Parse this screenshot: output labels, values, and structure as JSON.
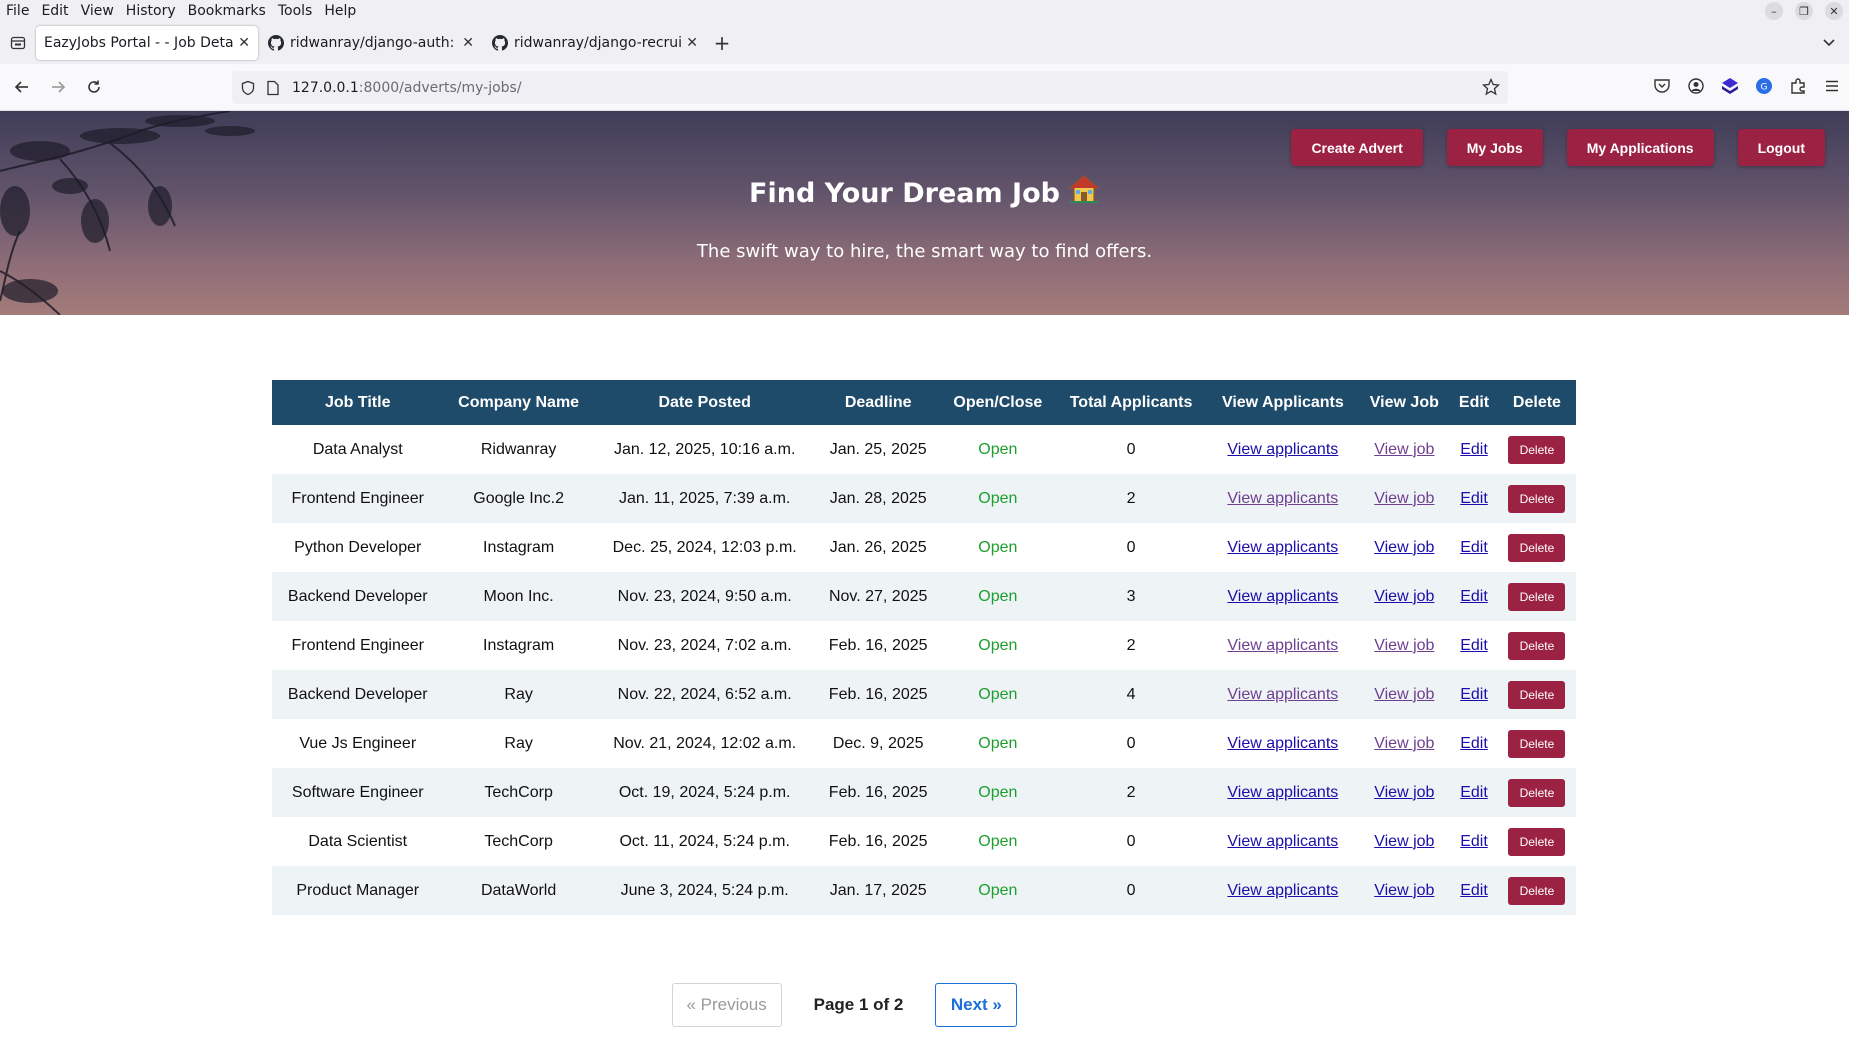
{
  "browser": {
    "menu": [
      "File",
      "Edit",
      "View",
      "History",
      "Bookmarks",
      "Tools",
      "Help"
    ],
    "tabs": [
      {
        "label": "EazyJobs Portal - - Job Detai",
        "active": true
      },
      {
        "label": "ridwanray/django-auth: A",
        "active": false
      },
      {
        "label": "ridwanray/django-recruit",
        "active": false
      }
    ],
    "url_host": "127.0.0.1",
    "url_path": ":8000/adverts/my-jobs/"
  },
  "hero": {
    "nav": [
      "Create Advert",
      "My Jobs",
      "My Applications",
      "Logout"
    ],
    "title": "Find Your Dream Job",
    "subtitle": "The swift way to hire, the smart way to find offers."
  },
  "table": {
    "headers": [
      "Job Title",
      "Company Name",
      "Date Posted",
      "Deadline",
      "Open/Close",
      "Total Applicants",
      "View Applicants",
      "View Job",
      "Edit",
      "Delete"
    ],
    "rows": [
      {
        "title": "Data Analyst",
        "company": "Ridwanray",
        "posted": "Jan. 12, 2025, 10:16 a.m.",
        "deadline": "Jan. 25, 2025",
        "status": "Open",
        "applicants": "0",
        "view_applicants": "View applicants",
        "view_job": "View job",
        "edit": "Edit",
        "delete": "Delete"
      },
      {
        "title": "Frontend Engineer",
        "company": "Google Inc.2",
        "posted": "Jan. 11, 2025, 7:39 a.m.",
        "deadline": "Jan. 28, 2025",
        "status": "Open",
        "applicants": "2",
        "view_applicants": "View applicants",
        "view_job": "View job",
        "edit": "Edit",
        "delete": "Delete"
      },
      {
        "title": "Python Developer",
        "company": "Instagram",
        "posted": "Dec. 25, 2024, 12:03 p.m.",
        "deadline": "Jan. 26, 2025",
        "status": "Open",
        "applicants": "0",
        "view_applicants": "View applicants",
        "view_job": "View job",
        "edit": "Edit",
        "delete": "Delete"
      },
      {
        "title": "Backend Developer",
        "company": "Moon Inc.",
        "posted": "Nov. 23, 2024, 9:50 a.m.",
        "deadline": "Nov. 27, 2025",
        "status": "Open",
        "applicants": "3",
        "view_applicants": "View applicants",
        "view_job": "View job",
        "edit": "Edit",
        "delete": "Delete"
      },
      {
        "title": "Frontend Engineer",
        "company": "Instagram",
        "posted": "Nov. 23, 2024, 7:02 a.m.",
        "deadline": "Feb. 16, 2025",
        "status": "Open",
        "applicants": "2",
        "view_applicants": "View applicants",
        "view_job": "View job",
        "edit": "Edit",
        "delete": "Delete"
      },
      {
        "title": "Backend Developer",
        "company": "Ray",
        "posted": "Nov. 22, 2024, 6:52 a.m.",
        "deadline": "Feb. 16, 2025",
        "status": "Open",
        "applicants": "4",
        "view_applicants": "View applicants",
        "view_job": "View job",
        "edit": "Edit",
        "delete": "Delete"
      },
      {
        "title": "Vue Js Engineer",
        "company": "Ray",
        "posted": "Nov. 21, 2024, 12:02 a.m.",
        "deadline": "Dec. 9, 2025",
        "status": "Open",
        "applicants": "0",
        "view_applicants": "View applicants",
        "view_job": "View job",
        "edit": "Edit",
        "delete": "Delete"
      },
      {
        "title": "Software Engineer",
        "company": "TechCorp",
        "posted": "Oct. 19, 2024, 5:24 p.m.",
        "deadline": "Feb. 16, 2025",
        "status": "Open",
        "applicants": "2",
        "view_applicants": "View applicants",
        "view_job": "View job",
        "edit": "Edit",
        "delete": "Delete"
      },
      {
        "title": "Data Scientist",
        "company": "TechCorp",
        "posted": "Oct. 11, 2024, 5:24 p.m.",
        "deadline": "Feb. 16, 2025",
        "status": "Open",
        "applicants": "0",
        "view_applicants": "View applicants",
        "view_job": "View job",
        "edit": "Edit",
        "delete": "Delete"
      },
      {
        "title": "Product Manager",
        "company": "DataWorld",
        "posted": "June 3, 2024, 5:24 p.m.",
        "deadline": "Jan. 17, 2025",
        "status": "Open",
        "applicants": "0",
        "view_applicants": "View applicants",
        "view_job": "View job",
        "edit": "Edit",
        "delete": "Delete"
      }
    ]
  },
  "pagination": {
    "previous": "« Previous",
    "info": "Page 1 of 2",
    "next": "Next »"
  },
  "colors": {
    "accent": "#9b2243",
    "table_header": "#1f4b6a",
    "status_open": "#1e9e2f",
    "link": "#1a0dab"
  }
}
